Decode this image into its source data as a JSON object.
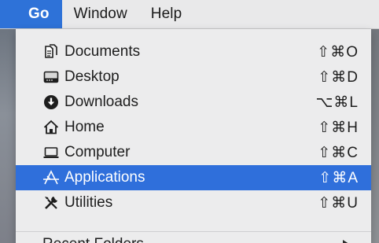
{
  "menubar": {
    "items": [
      {
        "label": "Go"
      },
      {
        "label": "Window"
      },
      {
        "label": "Help"
      }
    ]
  },
  "menu": {
    "items": [
      {
        "label": "Documents",
        "shortcut": "⇧⌘O",
        "icon": "documents-icon"
      },
      {
        "label": "Desktop",
        "shortcut": "⇧⌘D",
        "icon": "desktop-icon"
      },
      {
        "label": "Downloads",
        "shortcut": "⌥⌘L",
        "icon": "downloads-icon"
      },
      {
        "label": "Home",
        "shortcut": "⇧⌘H",
        "icon": "home-icon"
      },
      {
        "label": "Computer",
        "shortcut": "⇧⌘C",
        "icon": "computer-icon"
      },
      {
        "label": "Applications",
        "shortcut": "⇧⌘A",
        "icon": "applications-icon",
        "highlighted": true
      },
      {
        "label": "Utilities",
        "shortcut": "⇧⌘U",
        "icon": "utilities-icon"
      }
    ],
    "recent_folders_label": "Recent Folders"
  },
  "colors": {
    "highlight": "#2f6fdb",
    "menu_bg": "#ececed",
    "menubar_bg": "#e9e9ea"
  }
}
